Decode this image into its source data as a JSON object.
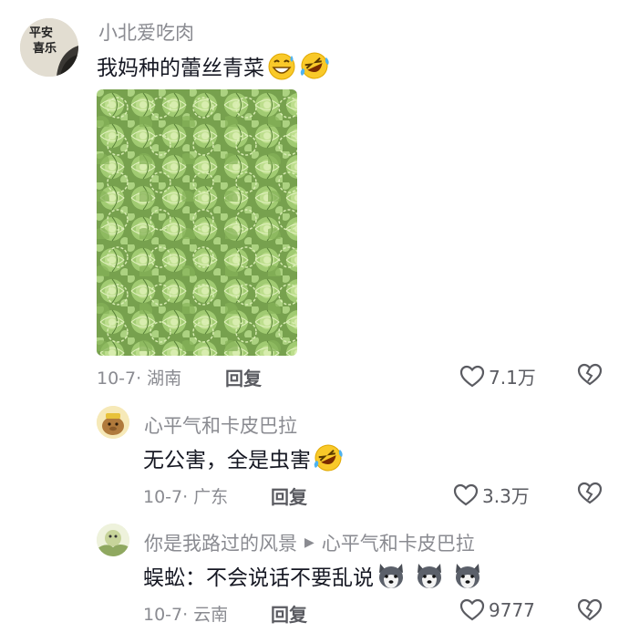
{
  "comments": [
    {
      "author": "小北爱吃肉",
      "text": "我妈种的蕾丝青菜",
      "emojis": [
        "grinning-sweat-emoji",
        "rolling-laughing-emoji"
      ],
      "date": "10-7",
      "location": "湖南",
      "reply_label": "回复",
      "likes": "7.1万",
      "avatar_text": [
        "平安",
        "喜乐"
      ]
    },
    {
      "author": "心平气和卡皮巴拉",
      "text": "无公害，全是虫害",
      "emojis": [
        "rolling-laughing-emoji"
      ],
      "date": "10-7",
      "location": "广东",
      "reply_label": "回复",
      "likes": "3.3万"
    },
    {
      "author": "你是我路过的风景",
      "reply_to": "心平气和卡皮巴拉",
      "text": "蜈蚣：不会说话不要乱说",
      "emojis": [
        "husky-emoji",
        "husky-emoji",
        "husky-emoji"
      ],
      "date": "10-7",
      "location": "云南",
      "reply_label": "回复",
      "likes": "9777"
    }
  ],
  "meta_separator": "·",
  "colors": {
    "name": "#8a8b91",
    "text": "#161823",
    "icon": "#5a5b61"
  }
}
